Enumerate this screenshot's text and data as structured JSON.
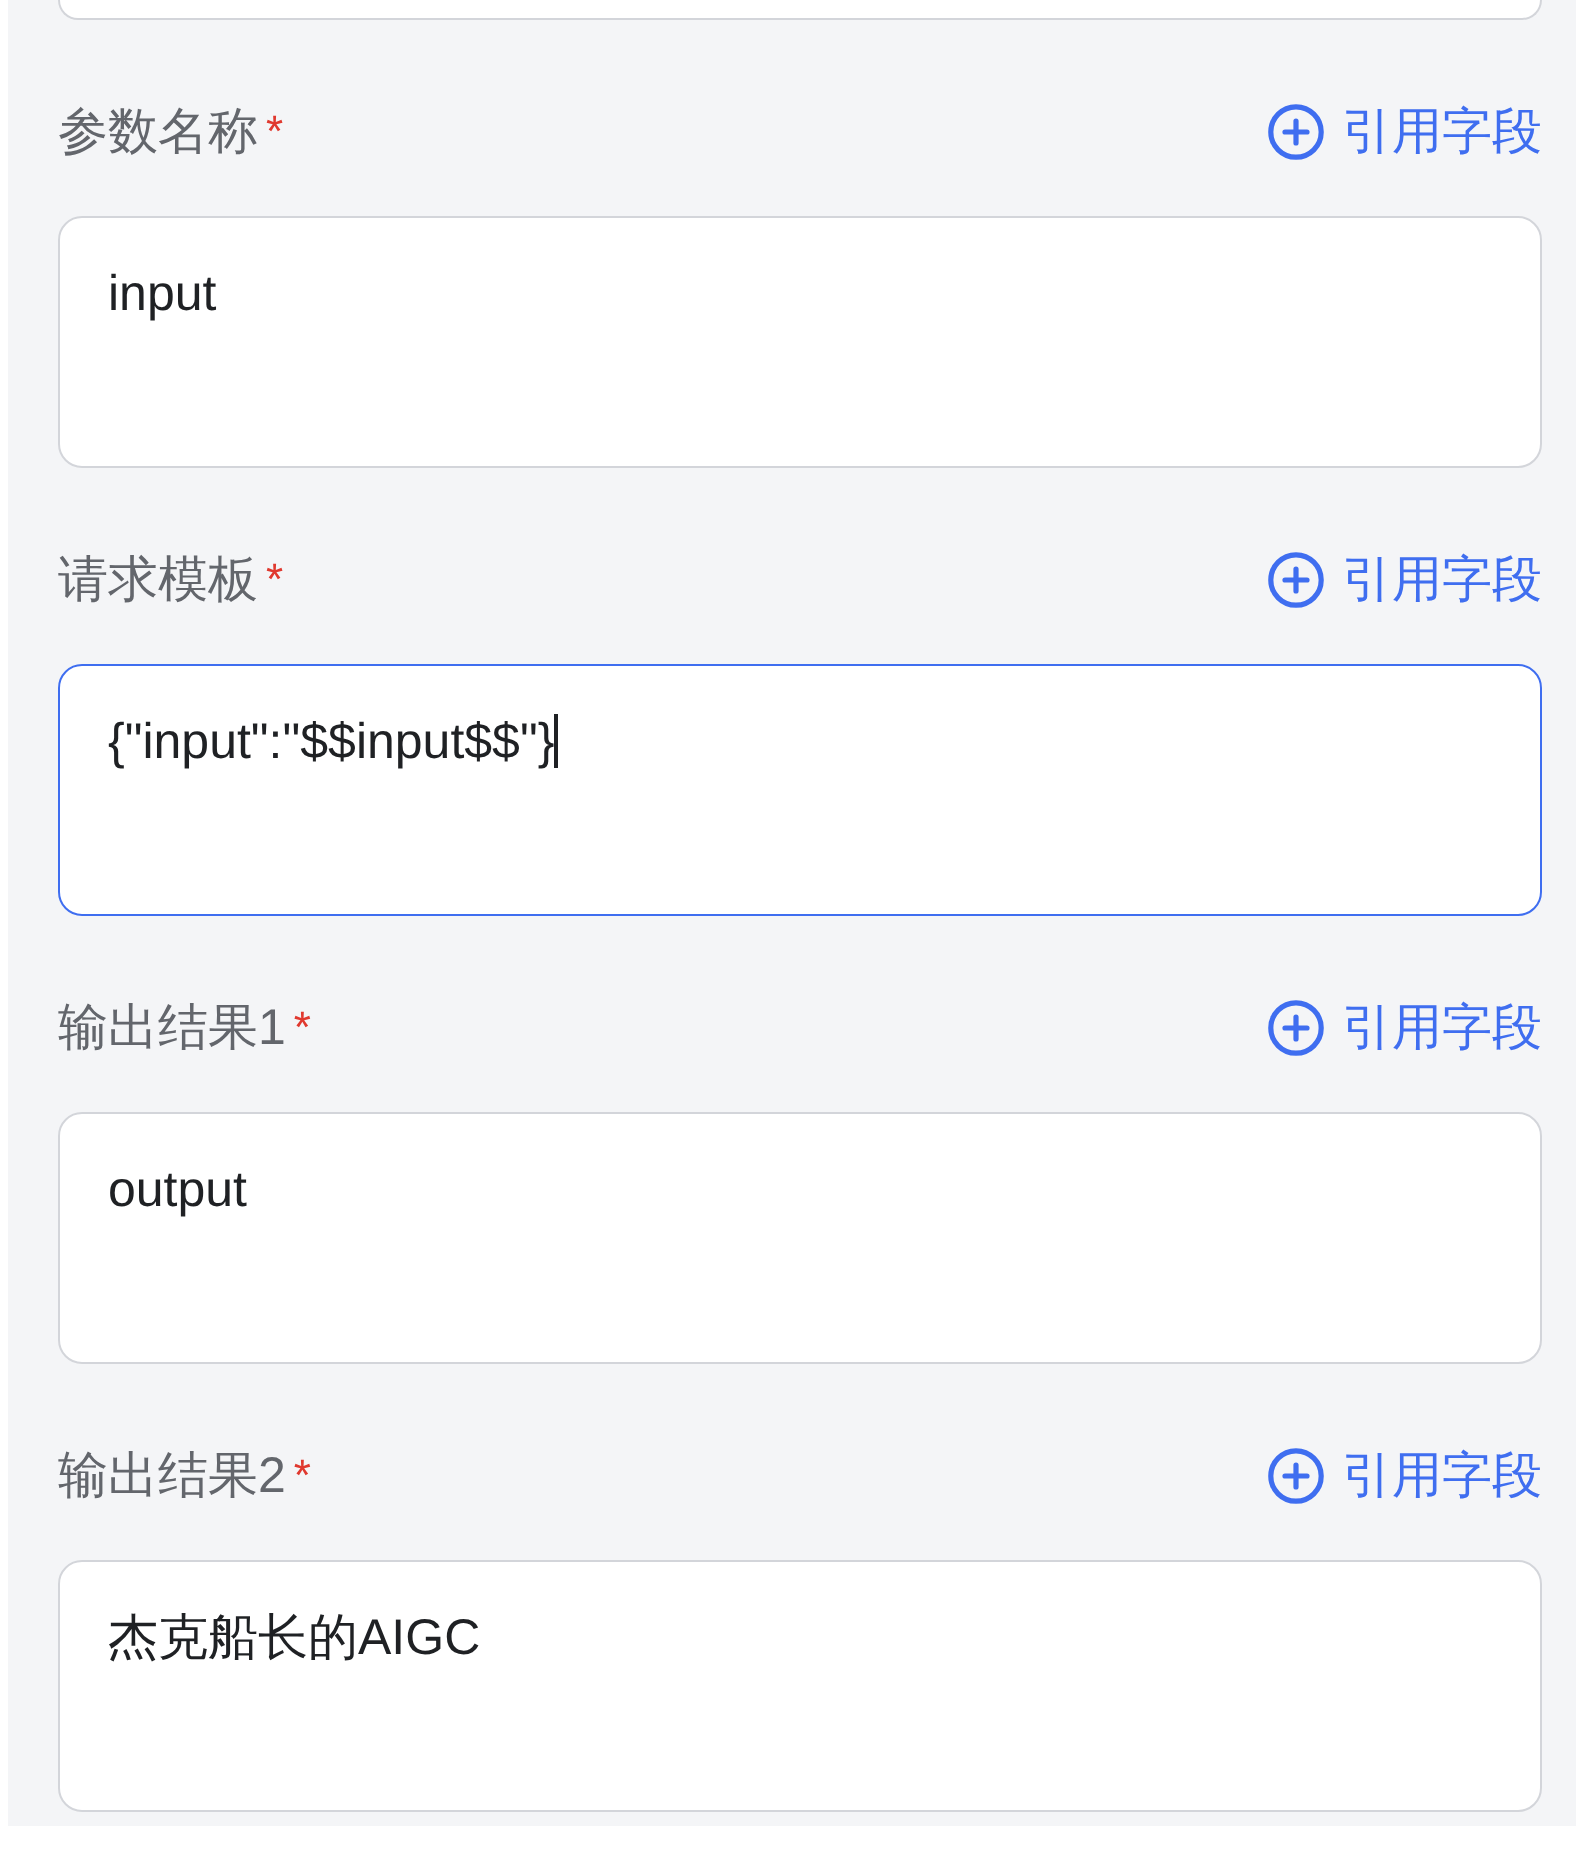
{
  "fields": [
    {
      "kind": "clipped"
    },
    {
      "kind": "textarea",
      "label": "参数名称",
      "required_mark": "*",
      "action": "引用字段",
      "value": "input",
      "focused": false
    },
    {
      "kind": "textarea",
      "label": "请求模板",
      "required_mark": "*",
      "action": "引用字段",
      "value": "{\"input\":\"$$input$$\"}",
      "focused": true
    },
    {
      "kind": "textarea",
      "label": "输出结果1",
      "required_mark": "*",
      "action": "引用字段",
      "value": "output",
      "focused": false
    },
    {
      "kind": "textarea",
      "label": "输出结果2",
      "required_mark": "*",
      "action": "引用字段",
      "value": "杰克船长的AIGC",
      "focused": false
    }
  ]
}
